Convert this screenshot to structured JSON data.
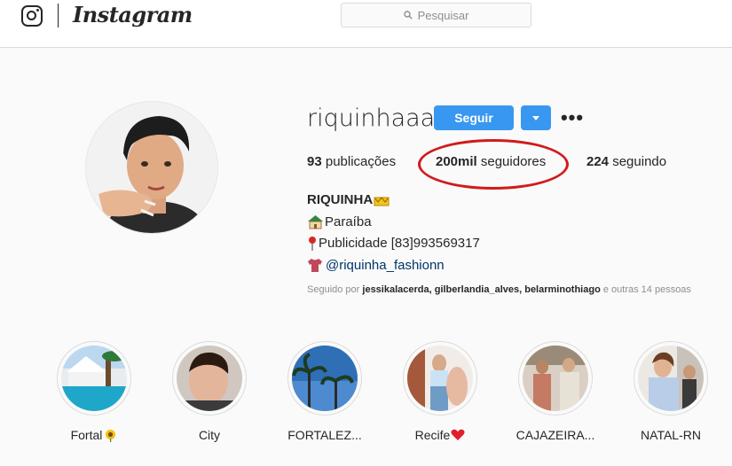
{
  "nav": {
    "brand": "Instagram",
    "search_placeholder": "Pesquisar"
  },
  "profile": {
    "username": "riquinhaaa",
    "follow_label": "Seguir",
    "more_label": "•••",
    "stats": {
      "posts_count": "93",
      "posts_label": "publicações",
      "followers_count": "200mil",
      "followers_label": "seguidores",
      "following_count": "224",
      "following_label": "seguindo"
    },
    "annotation_color": "#d11b1b",
    "bio": {
      "name": "RIQUINHA",
      "location": "Paraíba",
      "contact": "Publicidade [83]993569317",
      "link": "@riquinha_fashionn"
    },
    "followed_by": {
      "prefix": "Seguido por",
      "names": "jessikalacerda, gilberlandia_alves, belarminothiago",
      "suffix": "e outras 14 pessoas"
    }
  },
  "highlights": [
    {
      "label": "Fortal",
      "icon": "sunflower-icon"
    },
    {
      "label": "City",
      "icon": ""
    },
    {
      "label": "FORTALEZ...",
      "icon": ""
    },
    {
      "label": "Recife",
      "icon": "heart-icon"
    },
    {
      "label": "CAJAZEIRA...",
      "icon": ""
    },
    {
      "label": "NATAL-RN",
      "icon": ""
    }
  ],
  "colors": {
    "accent": "#3897f0",
    "link": "#003569",
    "muted": "#8e8e8e",
    "border": "#dbdbdb"
  }
}
